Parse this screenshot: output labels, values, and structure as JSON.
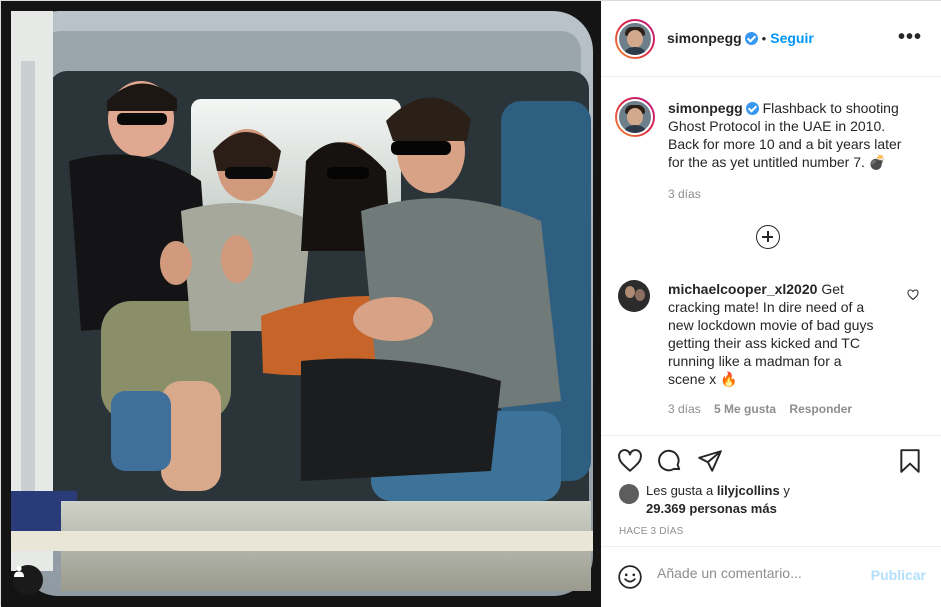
{
  "post": {
    "author": "simonpegg",
    "follow_label": "Seguir",
    "separator": "•",
    "more_label": "•••",
    "caption": {
      "username": "simonpegg",
      "text": "Flashback to shooting Ghost Protocol in the UAE in 2010. Back for more 10 and a bit years later for the as yet untitled number 7.",
      "emoji": "💣",
      "time": "3 días"
    },
    "comments": [
      {
        "username": "michaelcooper_xl2020",
        "text": "Get cracking mate! In dire need of a new lockdown movie of bad guys getting their ass kicked and TC running like a madman for a scene x",
        "emoji": "🔥",
        "time": "3 días",
        "likes": "5 Me gusta",
        "reply": "Responder"
      }
    ],
    "likes": {
      "prefix": "Les gusta a",
      "user": "lilyjcollins",
      "suffix": "y",
      "count_text": "29.369 personas más"
    },
    "time_ago": "HACE 3 DÍAS",
    "add_comment": {
      "placeholder": "Añade un comentario...",
      "publish_label": "Publicar"
    }
  },
  "colors": {
    "accent": "#0095f6",
    "publish_disabled": "#b2dffc",
    "muted": "#8e8e8e",
    "verified": "#3897f0"
  },
  "icons": {
    "like": "heart-icon",
    "comment": "comment-bubble-icon",
    "share": "paper-plane-icon",
    "save": "bookmark-icon",
    "emoji": "smiley-icon",
    "tag": "user-tag-icon"
  }
}
